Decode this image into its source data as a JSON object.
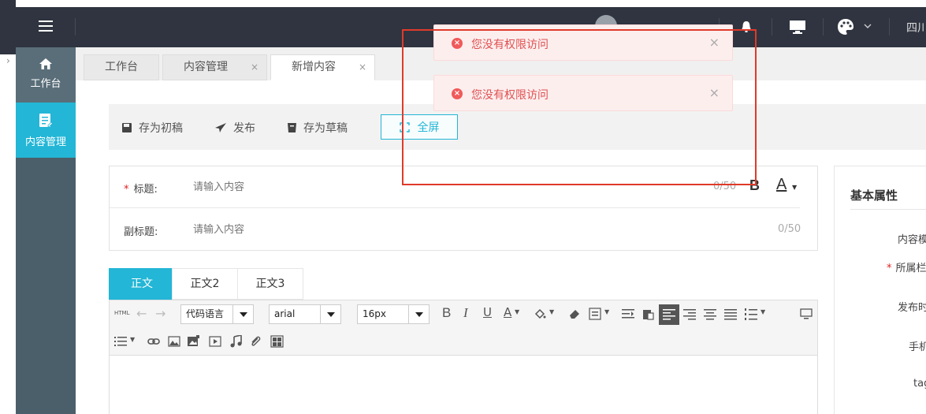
{
  "header": {
    "region": "四川"
  },
  "sidebar": {
    "items": [
      {
        "label": "工作台"
      },
      {
        "label": "内容管理"
      }
    ]
  },
  "tabs": [
    {
      "label": "工作台"
    },
    {
      "label": "内容管理",
      "close": "×"
    },
    {
      "label": "新增内容",
      "close": "×"
    }
  ],
  "toolbar": {
    "save_initial": "存为初稿",
    "publish": "发布",
    "save_draft": "存为草稿",
    "fullscreen": "全屏"
  },
  "form": {
    "title_label": "标题:",
    "required_mark": "*",
    "title_placeholder": "请输入内容",
    "title_counter": "0/50",
    "subtitle_label": "副标题:",
    "subtitle_placeholder": "请输入内容",
    "subtitle_counter": "0/50"
  },
  "editor": {
    "tabs": [
      {
        "label": "正文"
      },
      {
        "label": "正文2"
      },
      {
        "label": "正文3"
      }
    ],
    "html_label": "HTML",
    "code_lang": "代码语言",
    "font_family": "arial",
    "font_size": "16px"
  },
  "right_panel": {
    "title": "基本属性",
    "labels": [
      "内容模",
      "所属栏",
      "发布时",
      "手机",
      "tag"
    ]
  },
  "toasts": [
    {
      "message": "您没有权限访问",
      "close": "×"
    },
    {
      "message": "您没有权限访问",
      "close": "×"
    }
  ],
  "colors": {
    "accent": "#23b6d6",
    "topbar": "#2f3440",
    "sidebar": "#4b5f6b",
    "error": "#e05050",
    "highlight_box": "#e03a2a"
  }
}
